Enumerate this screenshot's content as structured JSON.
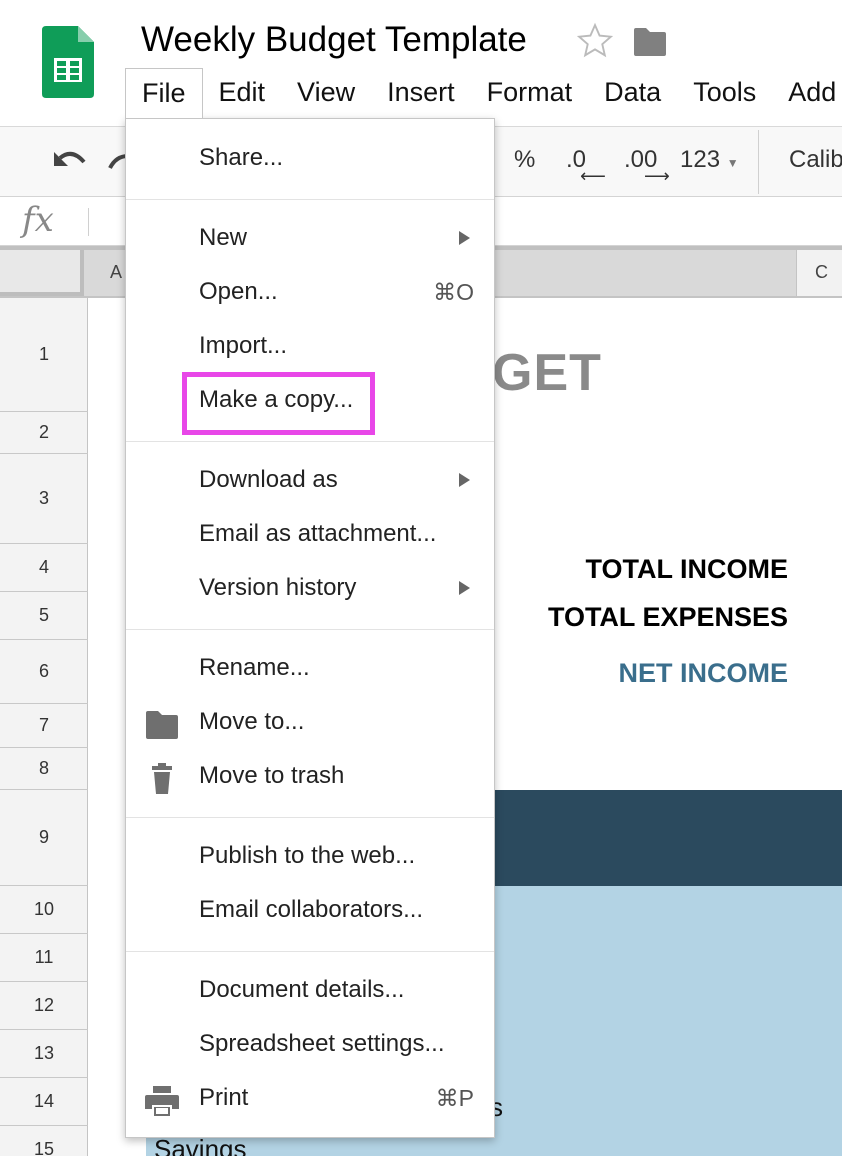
{
  "app": {
    "doc_title": "Weekly Budget Template",
    "menubar": [
      "File",
      "Edit",
      "View",
      "Insert",
      "Format",
      "Data",
      "Tools",
      "Add"
    ],
    "open_menu": "File",
    "colors": {
      "logo_green": "#0F9D58",
      "highlight": "#E847E8",
      "dark_band": "#2B4A5E",
      "light_band": "#B3D3E4",
      "net_income": "#3A6E8C"
    }
  },
  "toolbar": {
    "percent": "%",
    "decrease_decimal": ".0",
    "increase_decimal": ".00",
    "more_formats": "123",
    "font": "Calibri"
  },
  "formula_bar": {
    "fx": "fx"
  },
  "grid": {
    "columns": [
      "A",
      "C"
    ],
    "rows": [
      "1",
      "2",
      "3",
      "4",
      "5",
      "6",
      "7",
      "8",
      "9",
      "10",
      "11",
      "12",
      "13",
      "14",
      "15"
    ],
    "title_fragment": "GET",
    "summary": {
      "total_income": "TOTAL INCOME",
      "total_expenses": "TOTAL EXPENSES",
      "net_income": "NET INCOME"
    },
    "cell_fragment_s": "s",
    "savings": "Savings"
  },
  "file_menu": {
    "share": "Share...",
    "new": "New",
    "open": "Open...",
    "open_shortcut": "⌘O",
    "import": "Import...",
    "make_copy": "Make a copy...",
    "download_as": "Download as",
    "email_attachment": "Email as attachment...",
    "version_history": "Version history",
    "rename": "Rename...",
    "move_to": "Move to...",
    "move_to_trash": "Move to trash",
    "publish": "Publish to the web...",
    "email_collaborators": "Email collaborators...",
    "document_details": "Document details...",
    "spreadsheet_settings": "Spreadsheet settings...",
    "print": "Print",
    "print_shortcut": "⌘P",
    "highlighted_item": "Make a copy..."
  }
}
